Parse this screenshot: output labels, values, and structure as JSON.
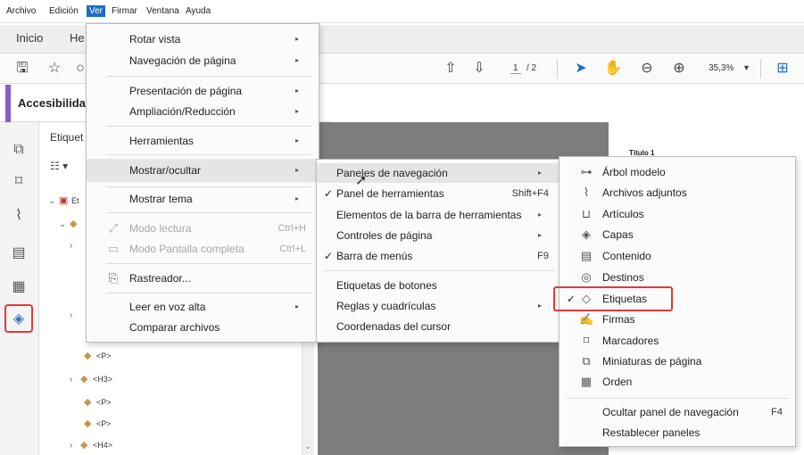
{
  "menubar": {
    "items": [
      "Archivo",
      "Edición",
      "Ver",
      "Firmar",
      "Ventana",
      "Ayuda"
    ],
    "active": "Ver"
  },
  "tabs": [
    "Inicio",
    "He"
  ],
  "toolbar": {
    "page_current": "1",
    "page_total": "/ 2",
    "zoom": "35,3%",
    "zoom_arrow": "▾",
    "icons": [
      "save-icon",
      "star-icon",
      "prev-page-icon",
      "next-page-icon",
      "select-arrow-icon",
      "hand-icon",
      "zoom-out-icon",
      "zoom-in-icon",
      "fit-page-icon"
    ]
  },
  "panel": {
    "title": "Accesibilida",
    "tags_header": "Etiquet",
    "tree_items": [
      {
        "chev": "⌄",
        "icon": "pdf",
        "text": "Et"
      },
      {
        "chev": "⌄",
        "icon": "tag",
        "text": ""
      },
      {
        "chev": "›",
        "icon": "",
        "text": ""
      },
      {
        "chev": "›",
        "icon": "",
        "text": ""
      },
      {
        "chev": "",
        "icon": "tag",
        "text": "<P>"
      },
      {
        "chev": "›",
        "icon": "tag",
        "text": "<H3>"
      },
      {
        "chev": "",
        "icon": "tag",
        "text": "<P>"
      },
      {
        "chev": "",
        "icon": "tag",
        "text": "<P>"
      },
      {
        "chev": "›",
        "icon": "tag",
        "text": "<H4>"
      }
    ]
  },
  "document": {
    "heading": "Título 1"
  },
  "menu_ver": {
    "items": [
      {
        "label": "Rotar vista",
        "arrow": "▸"
      },
      {
        "label": "Navegación de página",
        "arrow": "▸"
      },
      {
        "label": "Presentación de página",
        "arrow": "▸"
      },
      {
        "label": "Ampliación/Reducción",
        "arrow": "▸"
      },
      {
        "label": "Herramientas",
        "arrow": "▸"
      },
      {
        "label": "Mostrar/ocultar",
        "arrow": "▸"
      },
      {
        "label": "Mostrar tema",
        "arrow": "▸"
      },
      {
        "label": "Modo lectura",
        "shortcut": "Ctrl+H"
      },
      {
        "label": "Modo Pantalla completa",
        "shortcut": "Ctrl+L"
      },
      {
        "label": "Rastreador..."
      },
      {
        "label": "Leer en voz alta",
        "arrow": "▸"
      },
      {
        "label": "Comparar archivos"
      }
    ]
  },
  "menu_mostrar": {
    "items": [
      {
        "label": "Paneles de navegación",
        "arrow": "▸"
      },
      {
        "label": "Panel de herramientas",
        "shortcut": "Shift+F4",
        "check": "✓"
      },
      {
        "label": "Elementos de la barra de herramientas",
        "arrow": "▸"
      },
      {
        "label": "Controles de página",
        "arrow": "▸"
      },
      {
        "label": "Barra de menús",
        "shortcut": "F9",
        "check": "✓"
      },
      {
        "label": "Etiquetas de botones"
      },
      {
        "label": "Reglas y cuadrículas",
        "arrow": "▸"
      },
      {
        "label": "Coordenadas del cursor"
      }
    ]
  },
  "menu_paneles": {
    "items": [
      {
        "label": "Árbol modelo",
        "icon": "tree-model-icon"
      },
      {
        "label": "Archivos adjuntos",
        "icon": "paperclip-icon"
      },
      {
        "label": "Artículos",
        "icon": "articles-icon"
      },
      {
        "label": "Capas",
        "icon": "layers-icon"
      },
      {
        "label": "Contenido",
        "icon": "content-icon"
      },
      {
        "label": "Destinos",
        "icon": "destinations-icon"
      },
      {
        "label": "Etiquetas",
        "icon": "tag-icon",
        "check": "✓"
      },
      {
        "label": "Firmas",
        "icon": "signature-icon"
      },
      {
        "label": "Marcadores",
        "icon": "bookmark-icon"
      },
      {
        "label": "Miniaturas de página",
        "icon": "thumbnails-icon"
      },
      {
        "label": "Orden",
        "icon": "order-icon"
      },
      {
        "label": "Ocultar panel de navegación",
        "shortcut": "F4"
      },
      {
        "label": "Restablecer paneles"
      }
    ]
  },
  "colors": {
    "highlight_red": "#e03a3a",
    "accent_purple": "#8b5cc7",
    "menubar_active": "#1a6fc4"
  }
}
